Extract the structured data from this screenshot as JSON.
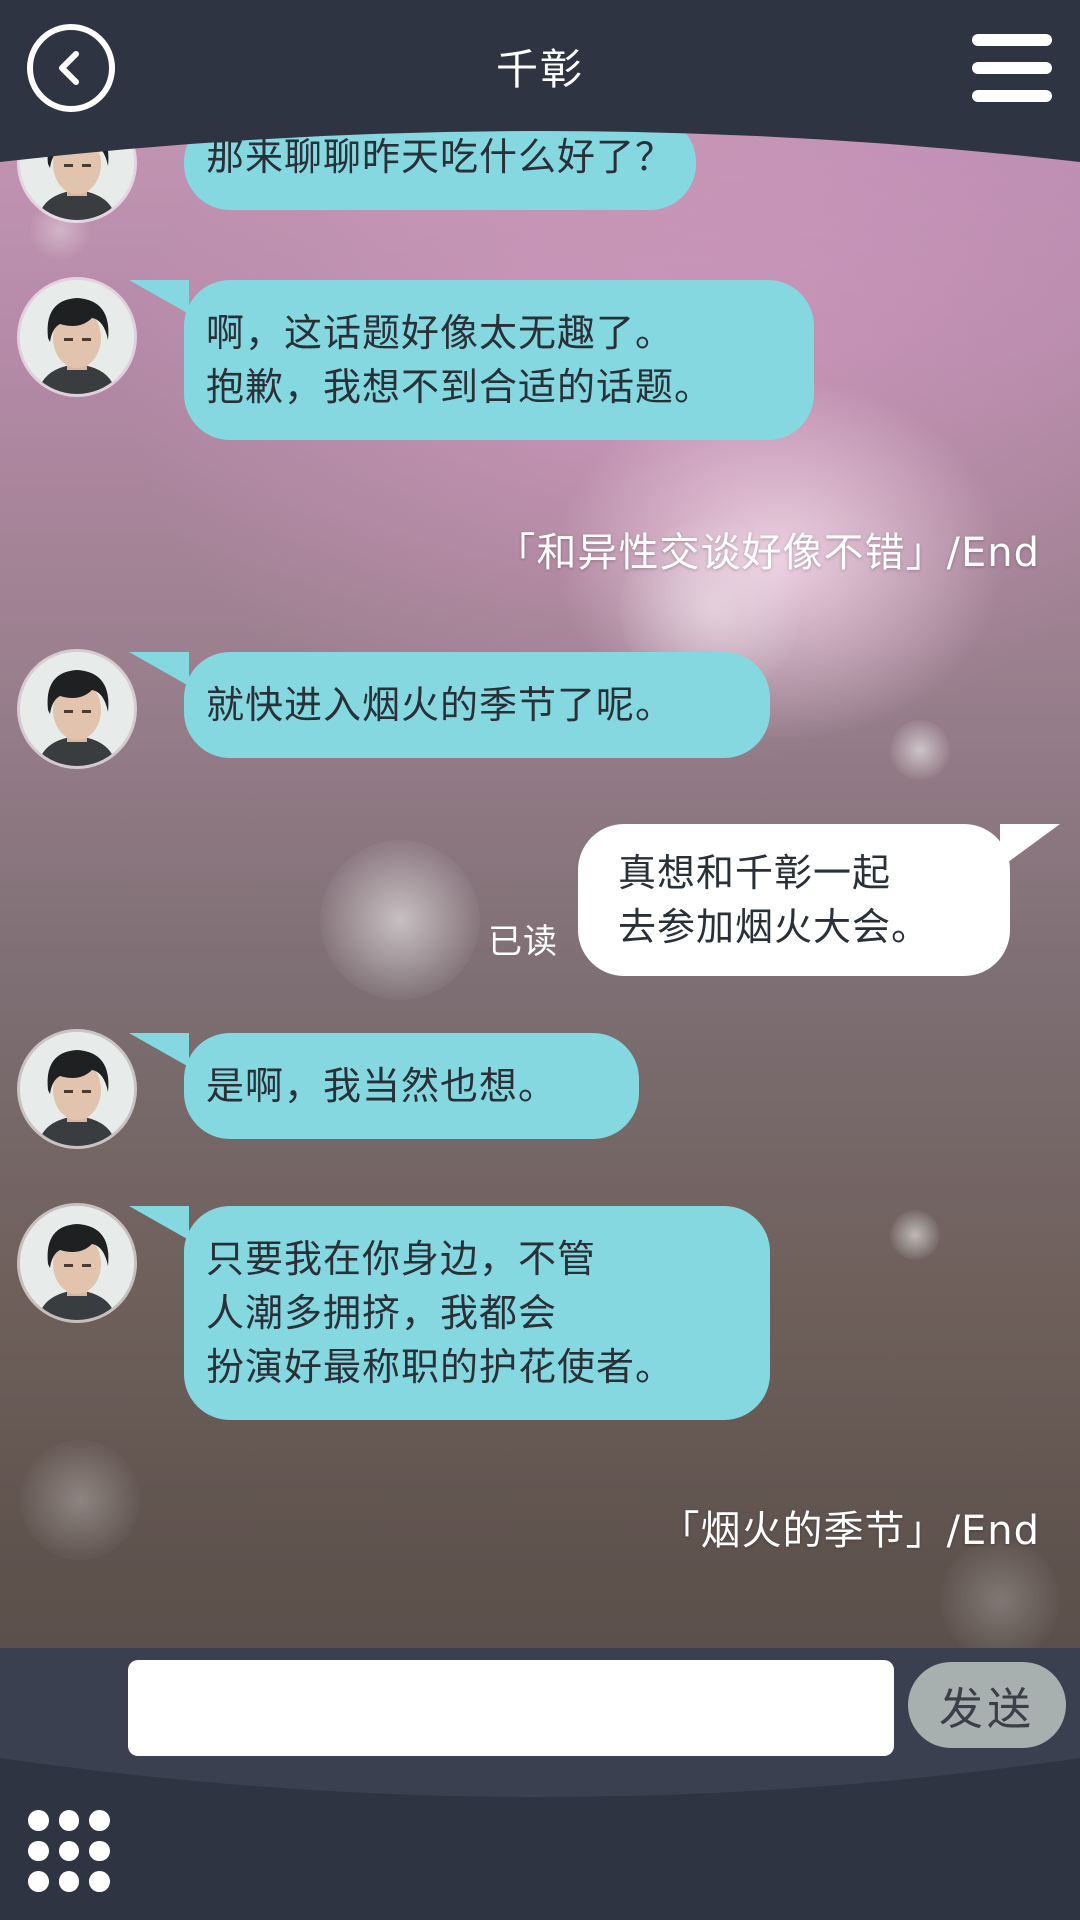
{
  "header": {
    "title": "千彰",
    "back_icon": "chevron-left-icon",
    "menu_icon": "hamburger-menu-icon"
  },
  "messages": [
    {
      "type": "incoming",
      "lines": [
        "那来聊聊昨天吃什么好了？"
      ]
    },
    {
      "type": "incoming",
      "lines": [
        "啊，这话题好像太无趣了。",
        "抱歉，我想不到合适的话题。"
      ]
    },
    {
      "type": "end",
      "text": "「和异性交谈好像不错」/End"
    },
    {
      "type": "incoming",
      "lines": [
        "就快进入烟火的季节了呢。"
      ]
    },
    {
      "type": "outgoing",
      "lines": [
        "真想和千彰一起",
        "去参加烟火大会。"
      ],
      "status": "已读"
    },
    {
      "type": "incoming",
      "lines": [
        "是啊，我当然也想。"
      ]
    },
    {
      "type": "incoming",
      "lines": [
        "只要我在你身边，不管",
        "人潮多拥挤，我都会",
        "扮演好最称职的护花使者。"
      ]
    },
    {
      "type": "end",
      "text": "「烟火的季节」/End"
    }
  ],
  "composer": {
    "input_value": "",
    "input_placeholder": "",
    "send_label": "发送",
    "menu_icon": "grid-dots-icon"
  },
  "colors": {
    "incoming_bubble": "#86d8e0",
    "outgoing_bubble": "#ffffff",
    "bar": "#2e3442",
    "send_button": "#a7afaf"
  }
}
